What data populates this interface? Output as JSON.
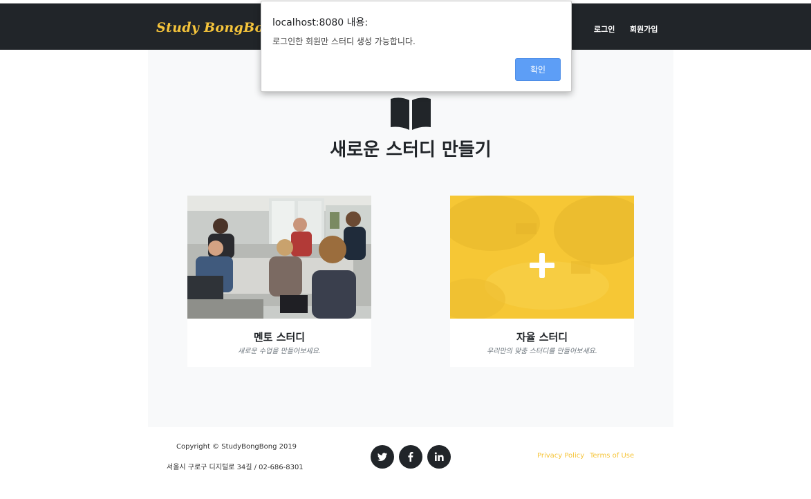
{
  "navbar": {
    "brand": "Study BongBong",
    "login_label": "로그인",
    "signup_label": "회원가입"
  },
  "main": {
    "title": "새로운 스터디 만들기",
    "cards": [
      {
        "title": "멘토 스터디",
        "subtitle": "새로운 수업을 만들어보세요."
      },
      {
        "title": "자율 스터디",
        "subtitle": "우리만의 맞춤 스터디를 만들어보세요."
      }
    ]
  },
  "footer": {
    "copyright": "Copyright © StudyBongBong 2019",
    "address": "서울시 구로구 디지털로 34길 / 02-686-8301",
    "social_icons": [
      "twitter-icon",
      "facebook-icon",
      "linkedin-icon"
    ],
    "privacy_label": "Privacy Policy",
    "terms_label": "Terms of Use"
  },
  "dialog": {
    "title": "localhost:8080 내용:",
    "message": "로그인한 회원만 스터디 생성 가능합니다.",
    "ok_label": "확인"
  },
  "colors": {
    "navbar_bg": "#212529",
    "accent_yellow": "#f6c53b",
    "main_bg": "#f8f9fa",
    "dialog_button": "#5d9ef6"
  }
}
